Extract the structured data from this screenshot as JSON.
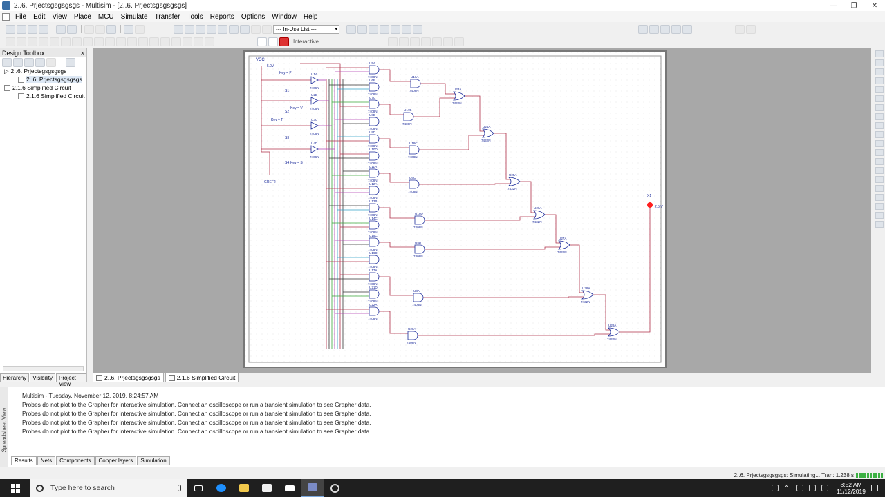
{
  "window": {
    "title": "2..6. Prjectsgsgsgsgs - Multisim - [2..6. Prjectsgsgsgsgs]"
  },
  "menu": [
    "File",
    "Edit",
    "View",
    "Place",
    "MCU",
    "Simulate",
    "Transfer",
    "Tools",
    "Reports",
    "Options",
    "Window",
    "Help"
  ],
  "toolbar": {
    "inuse_list": "--- In-Use List ---",
    "sim_mode": "Interactive"
  },
  "toolbox": {
    "title": "Design Toolbox",
    "tree": [
      {
        "label": "2..6. Prjectsgsgsgsgs"
      },
      {
        "label": "2..6. Prjectsgsgsgsgs"
      },
      {
        "label": "2.1.6 Simplified Circuit"
      },
      {
        "label": "2.1.6 Simplified Circuit"
      }
    ],
    "tabs": [
      "Hierarchy",
      "Visibility",
      "Project View"
    ]
  },
  "doc_tabs": [
    "2..6. Prjectsgsgsgsgs",
    "2.1.6 Simplified Circuit"
  ],
  "schematic": {
    "vcc": "VCC",
    "vcc_value": "5.0V",
    "ground": "GREF2",
    "switches": [
      {
        "name": "S1",
        "key": "Key = P"
      },
      {
        "name": "S2",
        "key": "Key = V"
      },
      {
        "name": "S3",
        "key": "Key = T"
      },
      {
        "name": "S4",
        "key": "Key = S"
      }
    ],
    "inverters": [
      {
        "name": "U1A",
        "part": "7406N"
      },
      {
        "name": "U2B",
        "part": "7406N"
      },
      {
        "name": "U3C",
        "part": "7406N"
      },
      {
        "name": "U4D",
        "part": "7406N"
      }
    ],
    "and_gates": [
      {
        "name": "U5A",
        "part": "7408N"
      },
      {
        "name": "U6B",
        "part": "7408N"
      },
      {
        "name": "U7C",
        "part": "7408N"
      },
      {
        "name": "U8D",
        "part": "7408N"
      },
      {
        "name": "U9D",
        "part": "7408N"
      },
      {
        "name": "U10D",
        "part": "7408N"
      },
      {
        "name": "U11A",
        "part": "7408N"
      },
      {
        "name": "U12A",
        "part": "7408N"
      },
      {
        "name": "U13B",
        "part": "7408N"
      },
      {
        "name": "U14C",
        "part": "7408N"
      },
      {
        "name": "U15C",
        "part": "7408N"
      },
      {
        "name": "U16D",
        "part": "7408N"
      },
      {
        "name": "U17A",
        "part": "7408N"
      },
      {
        "name": "U21D",
        "part": "7408N"
      },
      {
        "name": "U22A",
        "part": "7408N"
      }
    ],
    "mid_gates": [
      {
        "name": "U16A",
        "part": "7408N"
      },
      {
        "name": "U17B",
        "part": "7408N"
      },
      {
        "name": "U18C",
        "part": "7408N"
      },
      {
        "name": "U6C",
        "part": "7408N"
      },
      {
        "name": "U19D",
        "part": "7408N"
      },
      {
        "name": "U5D",
        "part": "7408N"
      },
      {
        "name": "U8A",
        "part": "7408N"
      },
      {
        "name": "U20A",
        "part": "7408N"
      }
    ],
    "or_gates": [
      {
        "name": "U23A",
        "part": "7432N"
      },
      {
        "name": "U24A",
        "part": "7432N"
      },
      {
        "name": "U25A",
        "part": "7432N"
      },
      {
        "name": "U26A",
        "part": "7432N"
      },
      {
        "name": "U27A",
        "part": "7432N"
      },
      {
        "name": "U28A",
        "part": "7432N"
      },
      {
        "name": "U29A",
        "part": "7432N"
      }
    ],
    "probe": {
      "name": "X1",
      "value": "2.5 V"
    }
  },
  "spreadsheet": {
    "label": "Spreadsheet View",
    "header": "Multisim  -  Tuesday, November 12, 2019, 8:24:57 AM",
    "messages": [
      "Probes do not plot to the Grapher for interactive simulation. Connect an oscilloscope or run a transient simulation to see Grapher data.",
      "Probes do not plot to the Grapher for interactive simulation. Connect an oscilloscope or run a transient simulation to see Grapher data.",
      "Probes do not plot to the Grapher for interactive simulation. Connect an oscilloscope or run a transient simulation to see Grapher data.",
      "Probes do not plot to the Grapher for interactive simulation. Connect an oscilloscope or run a transient simulation to see Grapher data."
    ],
    "tabs": [
      "Results",
      "Nets",
      "Components",
      "Copper layers",
      "Simulation"
    ]
  },
  "status": {
    "text": "2..6. Prjectsgsgsgsgs: Simulating... Tran: 1.238 s"
  },
  "taskbar": {
    "search_placeholder": "Type here to search",
    "time": "8:52 AM",
    "date": "11/12/2019"
  },
  "colors": {
    "wire_red": "#b0304a",
    "wire_green": "#3aa83a",
    "wire_purple": "#b040b0",
    "wire_cyan": "#30a0c8",
    "probe": "#ff2020",
    "gate": "#1a2a9a"
  }
}
